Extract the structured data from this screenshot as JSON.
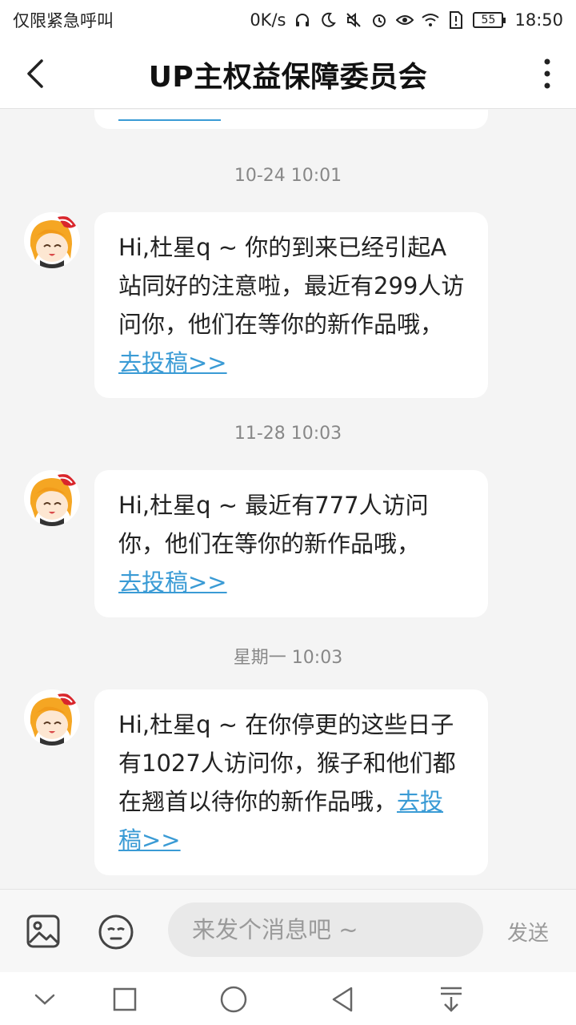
{
  "status_bar": {
    "left_text": "仅限紧急呼叫",
    "speed": "0K/s",
    "battery": "55",
    "time": "18:50"
  },
  "header": {
    "title": "UP主权益保障委员会"
  },
  "messages": [
    {
      "timestamp": "10-24 10:01",
      "text": "Hi,杜星q ~ 你的到来已经引起A站同好的注意啦，最近有299人访问你，他们在等你的新作品哦，",
      "link": "去投稿>>"
    },
    {
      "timestamp": "11-28 10:03",
      "text": "Hi,杜星q ~ 最近有777人访问你，他们在等你的新作品哦，",
      "link": "去投稿>>"
    },
    {
      "timestamp": "星期一 10:03",
      "text": "Hi,杜星q ~ 在你停更的这些日子有1027人访问你，猴子和他们都在翘首以待你的新作品哦，",
      "link": "去投稿>>"
    }
  ],
  "input_bar": {
    "placeholder": "来发个消息吧 ~",
    "send_label": "发送"
  },
  "colors": {
    "link": "#3a9bd5",
    "background": "#f4f4f4"
  }
}
